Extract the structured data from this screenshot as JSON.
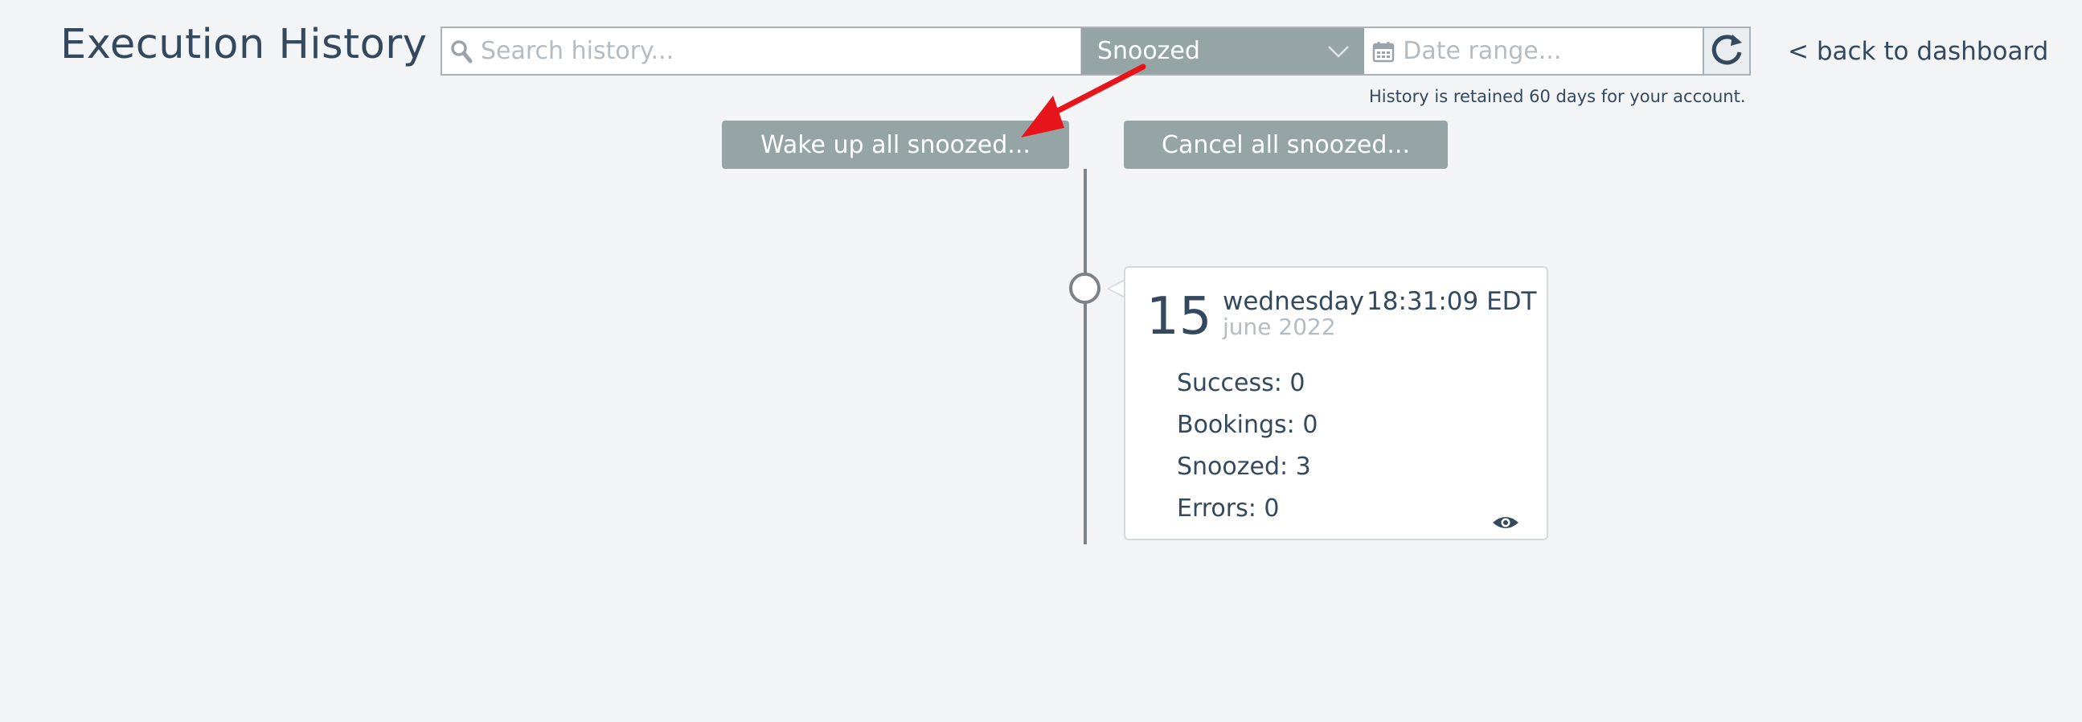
{
  "page": {
    "title": "Execution History",
    "back_link": "< back to dashboard",
    "retention_note": "History is retained 60 days for your account."
  },
  "filters": {
    "search_placeholder": "Search history...",
    "status_selected": "Snoozed",
    "date_placeholder": "Date range..."
  },
  "actions": {
    "wake_all": "Wake up all snoozed...",
    "cancel_all": "Cancel all snoozed..."
  },
  "entry": {
    "day": "15",
    "weekday": "wednesday",
    "time": "18:31:09 EDT",
    "month_year": "june 2022",
    "stats": [
      "Success: 0",
      "Bookings: 0",
      "Snoozed: 3",
      "Errors: 0"
    ]
  },
  "colors": {
    "accent_gray": "#95a5a6",
    "text_dark": "#34495e",
    "placeholder": "#b4bcc2",
    "annotation_arrow": "#e8141b"
  },
  "icons": [
    "search-icon",
    "chevron-down-icon",
    "calendar-icon",
    "refresh-icon",
    "eye-icon"
  ]
}
